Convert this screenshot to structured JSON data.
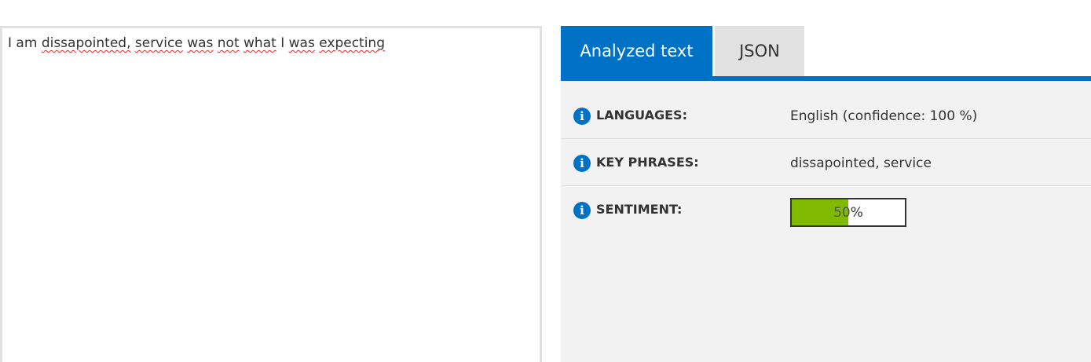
{
  "input": {
    "words": [
      {
        "text": "I",
        "misspelled": false
      },
      {
        "text": "am",
        "misspelled": false
      },
      {
        "text": "dissapointed,",
        "misspelled": true
      },
      {
        "text": "service",
        "misspelled": true
      },
      {
        "text": "was",
        "misspelled": true
      },
      {
        "text": "not",
        "misspelled": true
      },
      {
        "text": "what",
        "misspelled": true
      },
      {
        "text": "I",
        "misspelled": false
      },
      {
        "text": "was",
        "misspelled": true
      },
      {
        "text": "expecting",
        "misspelled": true
      }
    ]
  },
  "tabs": {
    "analyzed_label": "Analyzed text",
    "json_label": "JSON",
    "active": "analyzed"
  },
  "results": {
    "languages": {
      "label": "LANGUAGES:",
      "value": "English (confidence: 100 %)",
      "icon": "info-icon"
    },
    "key_phrases": {
      "label": "KEY PHRASES:",
      "value": "dissapointed, service",
      "icon": "info-icon"
    },
    "sentiment": {
      "label": "SENTIMENT:",
      "score_percent": 50,
      "score_text": "50",
      "unit": " %",
      "icon": "info-icon"
    }
  },
  "colors": {
    "accent": "#0072c6",
    "sentiment_fill": "#7fba00",
    "panel_bg": "#f2f2f2",
    "inactive_tab": "#e1e1e1"
  }
}
